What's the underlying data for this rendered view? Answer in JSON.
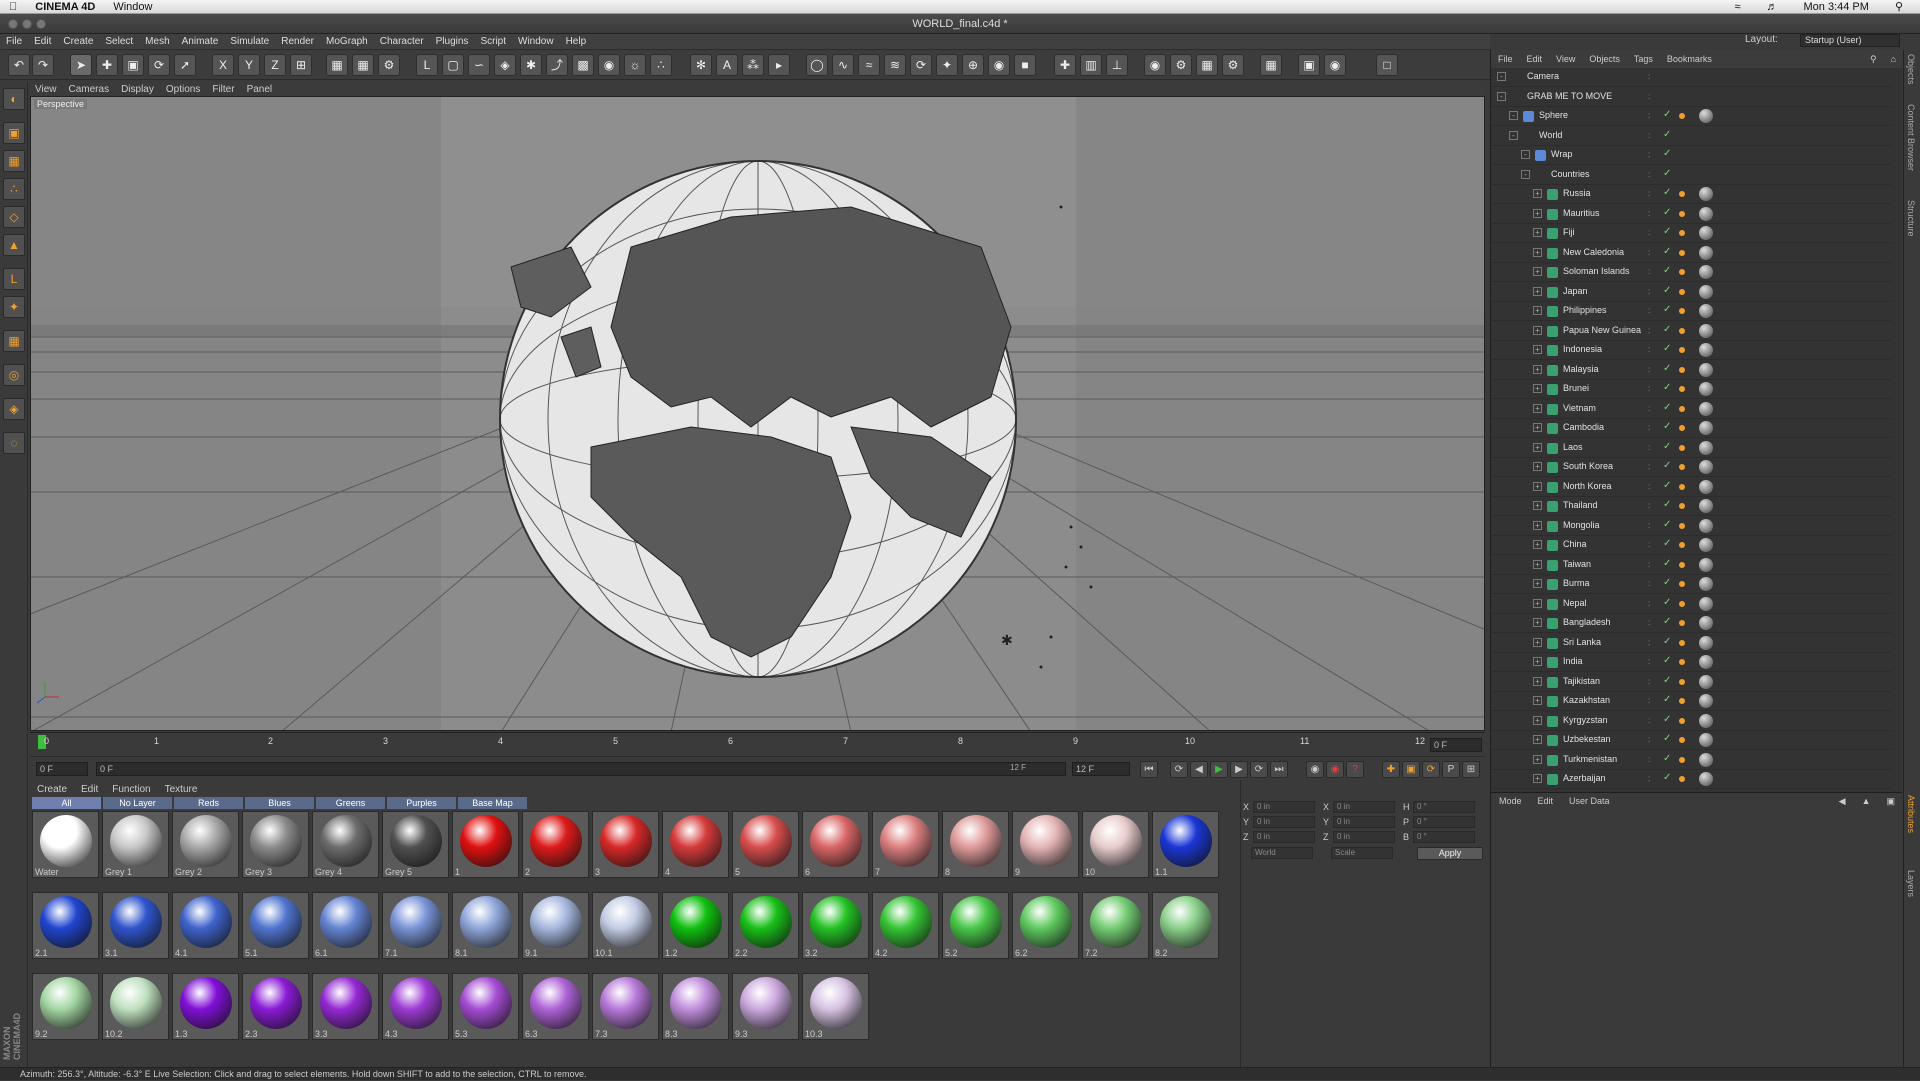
{
  "macbar": {
    "app_name": "CINEMA 4D",
    "menu": "Window",
    "clock": "Mon 3:44 PM"
  },
  "window": {
    "title": "WORLD_final.c4d *"
  },
  "main_menu": [
    "File",
    "Edit",
    "Create",
    "Select",
    "Mesh",
    "Animate",
    "Simulate",
    "Render",
    "MoGraph",
    "Character",
    "Plugins",
    "Script",
    "Window",
    "Help"
  ],
  "layout": {
    "label": "Layout:",
    "value": "Startup (User)"
  },
  "viewport": {
    "menu": [
      "View",
      "Cameras",
      "Display",
      "Options",
      "Filter",
      "Panel"
    ],
    "label": "Perspective"
  },
  "timeline": {
    "ticks": [
      "0",
      "1",
      "2",
      "3",
      "4",
      "5",
      "6",
      "7",
      "8",
      "9",
      "10",
      "11",
      "12"
    ],
    "current_frame": "0 F",
    "start_field": "0 F",
    "range_field": "0 F",
    "range_end": "12 F",
    "end_field": "12 F"
  },
  "material_manager": {
    "menu": [
      "Create",
      "Edit",
      "Function",
      "Texture"
    ],
    "tabs": [
      "All",
      "No Layer",
      "Reds",
      "Blues",
      "Greens",
      "Purples",
      "Base Map Colors"
    ],
    "materials": [
      {
        "name": "Water",
        "color": "#ffffff"
      },
      {
        "name": "Grey 1",
        "color": "#c8c8c8"
      },
      {
        "name": "Grey 2",
        "color": "#a9a9a9"
      },
      {
        "name": "Grey 3",
        "color": "#8c8c8c"
      },
      {
        "name": "Grey 4",
        "color": "#6d6d6d"
      },
      {
        "name": "Grey 5",
        "color": "#505050"
      },
      {
        "name": "1",
        "color": "#e01010"
      },
      {
        "name": "2",
        "color": "#dd1a1a"
      },
      {
        "name": "3",
        "color": "#d82828"
      },
      {
        "name": "4",
        "color": "#d63a3a"
      },
      {
        "name": "5",
        "color": "#d84d4d"
      },
      {
        "name": "6",
        "color": "#d96666"
      },
      {
        "name": "7",
        "color": "#dc7f7f"
      },
      {
        "name": "8",
        "color": "#df9a9a"
      },
      {
        "name": "9",
        "color": "#e4b4b4"
      },
      {
        "name": "10",
        "color": "#e8cccc"
      },
      {
        "name": "1.1",
        "color": "#1a36d6"
      },
      {
        "name": "2.1",
        "color": "#2045d0"
      },
      {
        "name": "3.1",
        "color": "#2f55cc"
      },
      {
        "name": "4.1",
        "color": "#3e63cc"
      },
      {
        "name": "5.1",
        "color": "#5074cf"
      },
      {
        "name": "6.1",
        "color": "#6484d2"
      },
      {
        "name": "7.1",
        "color": "#7994d6"
      },
      {
        "name": "8.1",
        "color": "#8fa6da"
      },
      {
        "name": "9.1",
        "color": "#a7b8df"
      },
      {
        "name": "10.1",
        "color": "#c2cce4"
      },
      {
        "name": "1.2",
        "color": "#10c010"
      },
      {
        "name": "2.2",
        "color": "#18c018"
      },
      {
        "name": "3.2",
        "color": "#24c224"
      },
      {
        "name": "4.2",
        "color": "#35c535"
      },
      {
        "name": "5.2",
        "color": "#48c748"
      },
      {
        "name": "6.2",
        "color": "#5ec95e"
      },
      {
        "name": "7.2",
        "color": "#74cc74"
      },
      {
        "name": "8.2",
        "color": "#8ad08a"
      },
      {
        "name": "9.2",
        "color": "#a3d6a3"
      },
      {
        "name": "10.2",
        "color": "#bfe0bf"
      },
      {
        "name": "1.3",
        "color": "#8010d8"
      },
      {
        "name": "2.3",
        "color": "#8a1ad6"
      },
      {
        "name": "3.3",
        "color": "#9528d4"
      },
      {
        "name": "4.3",
        "color": "#9d3ad4"
      },
      {
        "name": "5.3",
        "color": "#a54cd4"
      },
      {
        "name": "6.3",
        "color": "#ae62d6"
      },
      {
        "name": "7.3",
        "color": "#b778d8"
      },
      {
        "name": "8.3",
        "color": "#c08edb"
      },
      {
        "name": "9.3",
        "color": "#cba8de"
      },
      {
        "name": "10.3",
        "color": "#d6c2e2"
      }
    ]
  },
  "coordinates": {
    "rows": [
      {
        "a": "X",
        "av": "0 in",
        "b": "X",
        "bv": "0 in",
        "c": "H",
        "cv": "0 °"
      },
      {
        "a": "Y",
        "av": "0 in",
        "b": "Y",
        "bv": "0 in",
        "c": "P",
        "cv": "0 °"
      },
      {
        "a": "Z",
        "av": "0 in",
        "b": "Z",
        "bv": "0 in",
        "c": "B",
        "cv": "0 °"
      }
    ],
    "mode_select": "World",
    "scale_select": "Scale",
    "apply_label": "Apply"
  },
  "object_manager": {
    "menu": [
      "File",
      "Edit",
      "View",
      "Objects",
      "Tags",
      "Bookmarks"
    ],
    "objects": [
      {
        "name": "Camera",
        "indent": 0,
        "icon": "camera-icon"
      },
      {
        "name": "GRAB ME TO MOVE",
        "indent": 0,
        "icon": "null-icon"
      },
      {
        "name": "Sphere",
        "indent": 1,
        "icon": "sphere-icon"
      },
      {
        "name": "World",
        "indent": 1,
        "icon": "null-icon"
      },
      {
        "name": "Wrap",
        "indent": 2,
        "icon": "wrap-icon"
      },
      {
        "name": "Countries",
        "indent": 2,
        "icon": "null-icon"
      },
      {
        "name": "Russia",
        "indent": 3,
        "icon": "extrude-icon"
      },
      {
        "name": "Mauritius",
        "indent": 3,
        "icon": "extrude-icon"
      },
      {
        "name": "Fiji",
        "indent": 3,
        "icon": "extrude-icon"
      },
      {
        "name": "New Caledonia",
        "indent": 3,
        "icon": "extrude-icon"
      },
      {
        "name": "Soloman Islands",
        "indent": 3,
        "icon": "extrude-icon"
      },
      {
        "name": "Japan",
        "indent": 3,
        "icon": "extrude-icon"
      },
      {
        "name": "Philippines",
        "indent": 3,
        "icon": "extrude-icon"
      },
      {
        "name": "Papua New Guinea",
        "indent": 3,
        "icon": "extrude-icon"
      },
      {
        "name": "Indonesia",
        "indent": 3,
        "icon": "extrude-icon"
      },
      {
        "name": "Malaysia",
        "indent": 3,
        "icon": "extrude-icon"
      },
      {
        "name": "Brunei",
        "indent": 3,
        "icon": "extrude-icon"
      },
      {
        "name": "Vietnam",
        "indent": 3,
        "icon": "extrude-icon"
      },
      {
        "name": "Cambodia",
        "indent": 3,
        "icon": "extrude-icon"
      },
      {
        "name": "Laos",
        "indent": 3,
        "icon": "extrude-icon"
      },
      {
        "name": "South Korea",
        "indent": 3,
        "icon": "extrude-icon"
      },
      {
        "name": "North Korea",
        "indent": 3,
        "icon": "extrude-icon"
      },
      {
        "name": "Thailand",
        "indent": 3,
        "icon": "extrude-icon"
      },
      {
        "name": "Mongolia",
        "indent": 3,
        "icon": "extrude-icon"
      },
      {
        "name": "China",
        "indent": 3,
        "icon": "extrude-icon"
      },
      {
        "name": "Taiwan",
        "indent": 3,
        "icon": "extrude-icon"
      },
      {
        "name": "Burma",
        "indent": 3,
        "icon": "extrude-icon"
      },
      {
        "name": "Nepal",
        "indent": 3,
        "icon": "extrude-icon"
      },
      {
        "name": "Bangladesh",
        "indent": 3,
        "icon": "extrude-icon"
      },
      {
        "name": "Sri Lanka",
        "indent": 3,
        "icon": "extrude-icon"
      },
      {
        "name": "India",
        "indent": 3,
        "icon": "extrude-icon"
      },
      {
        "name": "Tajikistan",
        "indent": 3,
        "icon": "extrude-icon"
      },
      {
        "name": "Kazakhstan",
        "indent": 3,
        "icon": "extrude-icon"
      },
      {
        "name": "Kyrgyzstan",
        "indent": 3,
        "icon": "extrude-icon"
      },
      {
        "name": "Uzbekestan",
        "indent": 3,
        "icon": "extrude-icon"
      },
      {
        "name": "Turkmenistan",
        "indent": 3,
        "icon": "extrude-icon"
      },
      {
        "name": "Azerbaijan",
        "indent": 3,
        "icon": "extrude-icon"
      }
    ]
  },
  "attribute_manager": {
    "menu": [
      "Mode",
      "Edit",
      "User Data"
    ]
  },
  "right_tabs": [
    "Objects",
    "Content Browser",
    "Structure",
    "Attributes",
    "Layers"
  ],
  "status": "Azimuth: 256.3°, Altitude: -6.3° E  Live Selection: Click and drag to select elements. Hold down SHIFT to add to the selection, CTRL to remove.",
  "colors": {
    "accent": "#f0a030",
    "check": "#7fd07f",
    "tab": "#5a6a8a"
  }
}
